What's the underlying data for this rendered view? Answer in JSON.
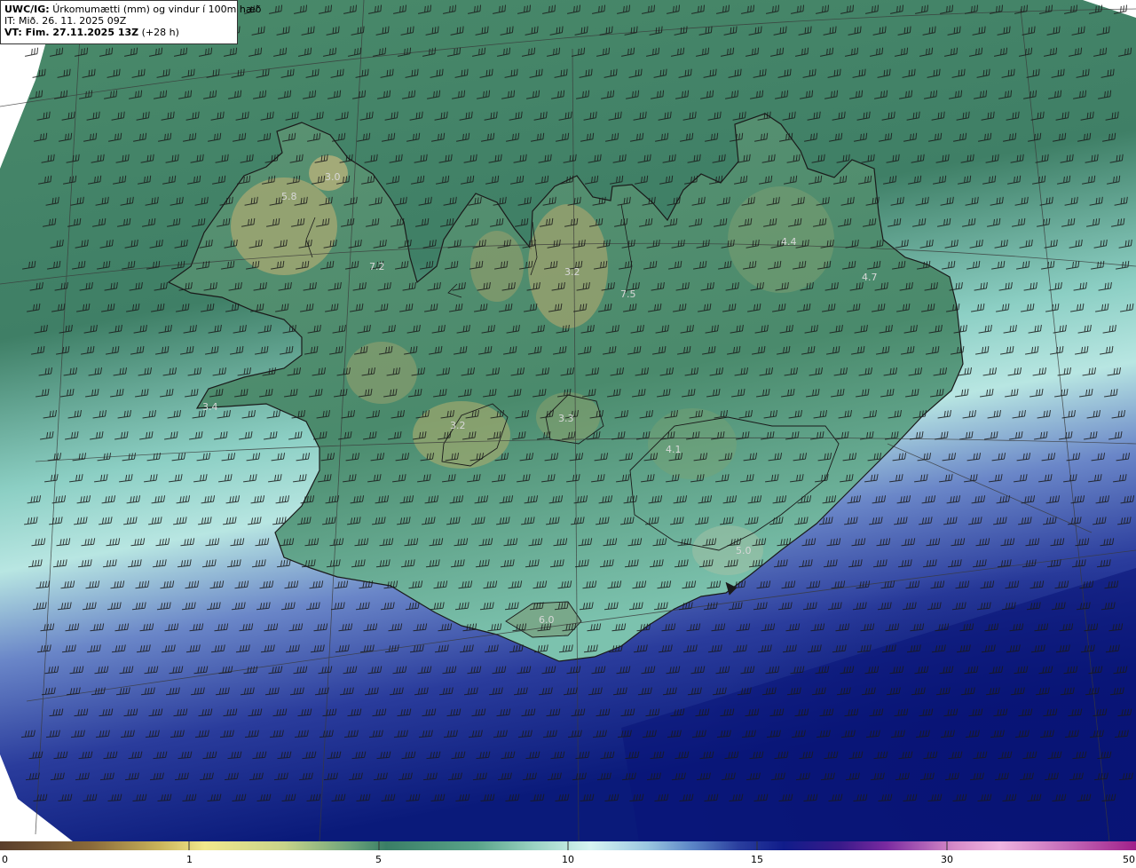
{
  "header": {
    "title_bold": "UWC/IG:",
    "title_rest": "Úrkomumætti (mm) og vindur í 100m hæð",
    "init_time": "IT: Mið. 26. 11. 2025 09Z",
    "valid_bold": "VT: Fim. 27.11.2025 13Z",
    "valid_rest": "(+28 h)"
  },
  "point_values": [
    {
      "label": "3.0"
    },
    {
      "label": "5.8"
    },
    {
      "label": "7.2"
    },
    {
      "label": "3.2"
    },
    {
      "label": "7.5"
    },
    {
      "label": "4.4"
    },
    {
      "label": "4.7"
    },
    {
      "label": "3.4"
    },
    {
      "label": "3.2"
    },
    {
      "label": "3.3"
    },
    {
      "label": "4.1"
    },
    {
      "label": "5.0"
    },
    {
      "label": "6.0"
    }
  ],
  "colorbar": {
    "ticks": [
      "0",
      "1",
      "5",
      "10",
      "15",
      "30",
      "50"
    ],
    "colors": [
      "#5a3e2b",
      "#8a6a3a",
      "#c9b35a",
      "#f2e88c",
      "#c8d48a",
      "#6aa27a",
      "#3a7e66",
      "#5aa48a",
      "#9ad2c2",
      "#d6f4f2",
      "#9ac6e0",
      "#5a84c6",
      "#2a3e9e",
      "#101c8a",
      "#3a1a8a",
      "#7a2aa0",
      "#d68ac8",
      "#f0b4e0",
      "#c46ab8",
      "#a0208a"
    ]
  },
  "colors": {
    "land_green": "#4e8a6a",
    "land_yellow": "#9aa870",
    "sea_green": "#3f7f66",
    "sea_light": "#a8ded6",
    "sea_blue": "#3a4ea8",
    "sea_navy": "#0a1a7a",
    "coastline": "#1a1a1a",
    "barb": "#1a1a1a"
  }
}
